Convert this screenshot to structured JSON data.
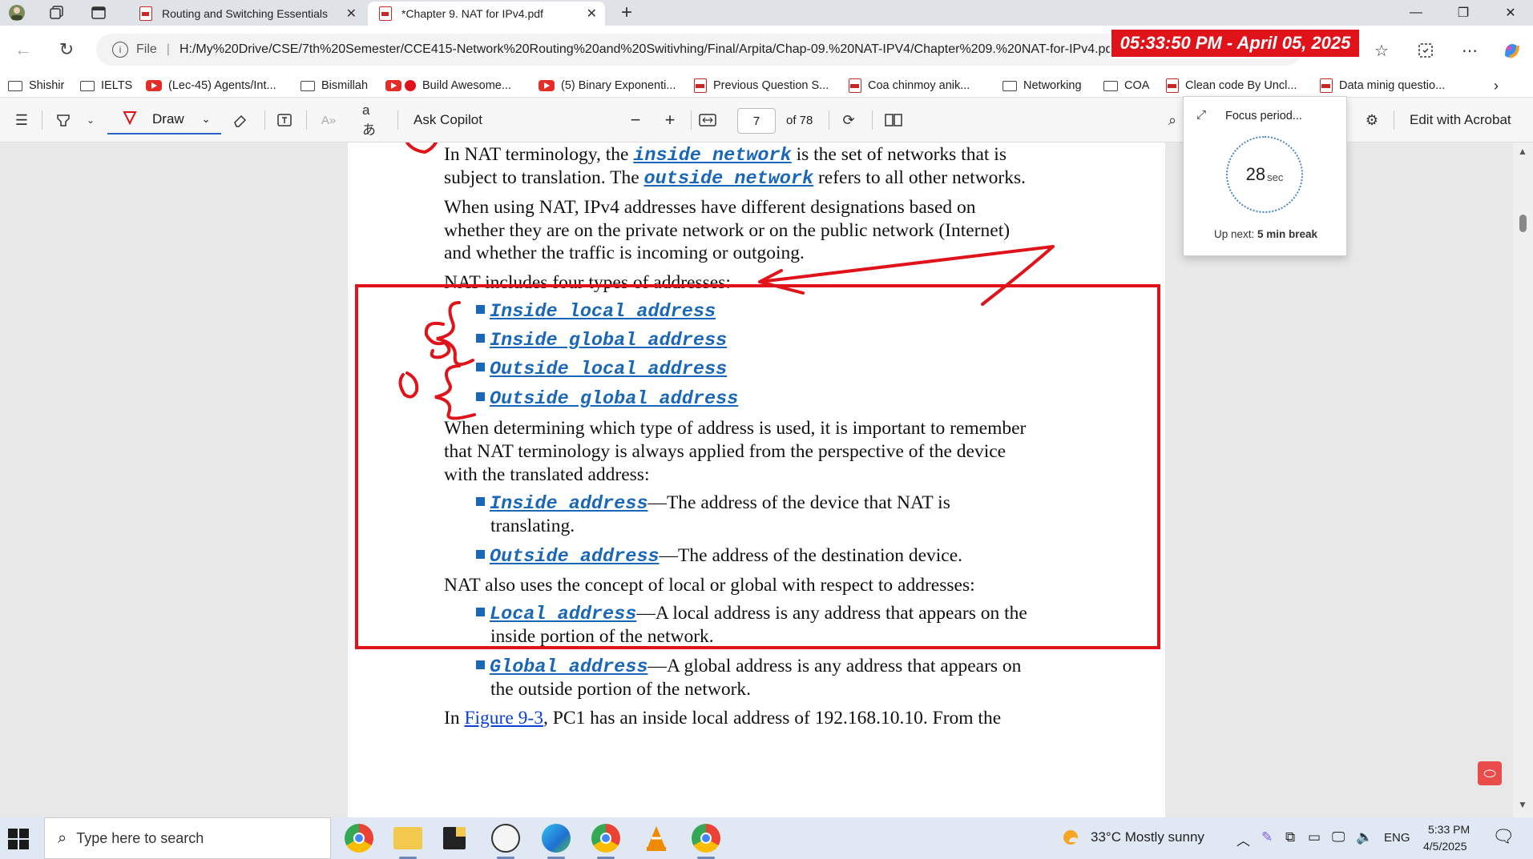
{
  "browser": {
    "tabs": [
      {
        "label": "Routing and Switching Essentials",
        "active": false
      },
      {
        "label": "*Chapter 9. NAT for IPv4.pdf",
        "active": true
      }
    ],
    "new_tab_label": "+",
    "url_prefix": "File",
    "url": "H:/My%20Drive/CSE/7th%20Semester/CCE415-Network%20Routing%20and%20Switivhing/Final/Arpita/Chap-09.%20NAT-IPV4/Chapter%209.%20NAT-for-IPv4.pdf"
  },
  "clock_overlay": "05:33:50 PM - April 05, 2025",
  "bookmarks": [
    {
      "label": "Shishir",
      "icon": "folder-icon"
    },
    {
      "label": "IELTS",
      "icon": "folder-icon"
    },
    {
      "label": "(Lec-45) Agents/Int...",
      "icon": "youtube-icon"
    },
    {
      "label": "Bismillah",
      "icon": "folder-icon"
    },
    {
      "label": "Build Awesome...",
      "icon": "youtube-icon"
    },
    {
      "label": "(5) Binary Exponenti...",
      "icon": "youtube-icon"
    },
    {
      "label": "Previous Question S...",
      "icon": "pdf-icon"
    },
    {
      "label": "Coa chinmoy anik...",
      "icon": "pdf-icon"
    },
    {
      "label": "Networking",
      "icon": "folder-icon"
    },
    {
      "label": "COA",
      "icon": "folder-icon"
    },
    {
      "label": "Clean code By Uncl...",
      "icon": "pdf-icon"
    },
    {
      "label": "Data minig questio...",
      "icon": "pdf-icon"
    }
  ],
  "pdf_toolbar": {
    "draw_label": "Draw",
    "ask_copilot": "Ask Copilot",
    "page_current": "7",
    "page_total": "of 78",
    "edit_acrobat": "Edit with Acrobat"
  },
  "focus_popup": {
    "title": "Focus period...",
    "seconds": "28",
    "unit": "sec",
    "up_next_prefix": "Up next: ",
    "up_next_value": "5 min break"
  },
  "document": {
    "p1a": "In NAT terminology, the ",
    "p1_term1": "inside network",
    "p1b": " is the set of networks that is",
    "p1c": "subject to translation. The ",
    "p1_term2": "outside network",
    "p1d": " refers to all other networks.",
    "p2_l1": "When using NAT, IPv4 addresses have different designations based on",
    "p2_l2": "whether they are on the private network or on the public network (Internet)",
    "p2_l3": "and whether the traffic is incoming or outgoing.",
    "p3": "NAT includes four types of addresses:",
    "types": [
      "Inside local address",
      "Inside global address",
      "Outside local address",
      "Outside global address"
    ],
    "p4_l1": "When determining which type of address is used, it is important to remember",
    "p4_l2": "that NAT terminology is always applied from the perspective of the device",
    "p4_l3": "with the translated address:",
    "def_inside_term": "Inside address",
    "def_inside_a": "—The address of the device that NAT is",
    "def_inside_b": "translating.",
    "def_outside_term": "Outside address",
    "def_outside_a": "—The address of the destination device.",
    "p5": "NAT also uses the concept of local or global with respect to addresses:",
    "def_local_term": "Local address",
    "def_local_a": "—A local address is any address that appears on the",
    "def_local_b": "inside portion of the network.",
    "def_global_term": "Global address",
    "def_global_a": "—A global address is any address that appears on",
    "def_global_b": "the outside portion of the network.",
    "p6a": "In ",
    "p6_link": "Figure 9-3",
    "p6b": ", PC1 has an inside local address of 192.168.10.10. From the"
  },
  "taskbar": {
    "search_placeholder": "Type here to search",
    "weather": "33°C  Mostly sunny",
    "language": "ENG",
    "time": "5:33 PM",
    "date": "4/5/2025"
  },
  "colors": {
    "annotation_red": "#e0131a",
    "term_blue": "#1a67b8",
    "accent": "#2a62c9"
  }
}
